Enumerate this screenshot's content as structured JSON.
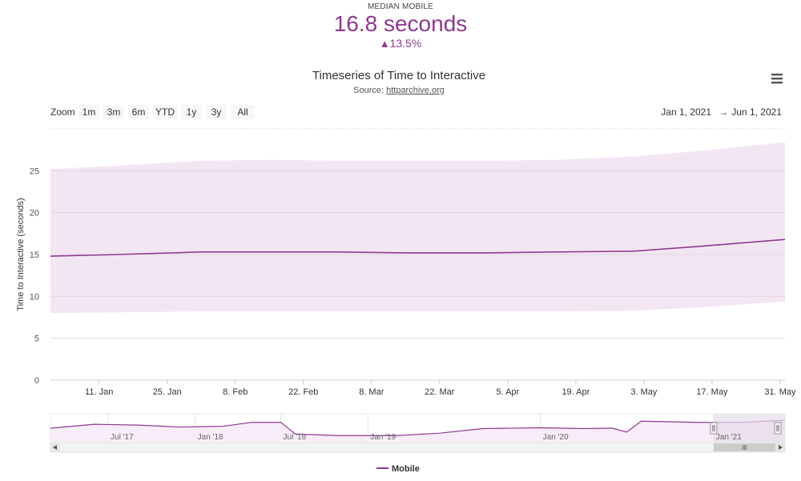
{
  "summary": {
    "label": "MEDIAN MOBILE",
    "value": "16.8 seconds",
    "change": "13.5%",
    "change_icon": "up-triangle-icon"
  },
  "colors": {
    "accent": "#8e3a91",
    "band": "#f3e6f3",
    "navigator_fill": "#f7ecf7",
    "navigator_mask": "#e6dde8"
  },
  "toolbar": {
    "zoom_label": "Zoom",
    "zoom_buttons": [
      "1m",
      "3m",
      "6m",
      "YTD",
      "1y",
      "3y",
      "All"
    ],
    "range_from": "Jan 1, 2021",
    "range_arrow": "→",
    "range_to": "Jun 1, 2021",
    "menu_icon": "hamburger-menu-icon"
  },
  "chart_data": {
    "type": "area",
    "title": "Timeseries of Time to Interactive",
    "subtitle_prefix": "Source: ",
    "subtitle_link": "httparchive.org",
    "ylabel": "Time to Interactive (seconds)",
    "ylim": [
      0,
      30
    ],
    "yticks": [
      0,
      5,
      10,
      15,
      20,
      25
    ],
    "xlim": [
      "2021-01-01",
      "2021-06-01"
    ],
    "xticks": [
      {
        "date": "2021-01-11",
        "label": "11. Jan"
      },
      {
        "date": "2021-01-25",
        "label": "25. Jan"
      },
      {
        "date": "2021-02-08",
        "label": "8. Feb"
      },
      {
        "date": "2021-02-22",
        "label": "22. Feb"
      },
      {
        "date": "2021-03-08",
        "label": "8. Mar"
      },
      {
        "date": "2021-03-22",
        "label": "22. Mar"
      },
      {
        "date": "2021-04-05",
        "label": "5. Apr"
      },
      {
        "date": "2021-04-19",
        "label": "19. Apr"
      },
      {
        "date": "2021-05-03",
        "label": "3. May"
      },
      {
        "date": "2021-05-17",
        "label": "17. May"
      },
      {
        "date": "2021-05-31",
        "label": "31. May"
      }
    ],
    "grid": true,
    "legend": "bottom-center",
    "series": [
      {
        "name": "Mobile",
        "points": [
          [
            "2021-01-01",
            14.8
          ],
          [
            "2021-01-15",
            15.0
          ],
          [
            "2021-02-01",
            15.3
          ],
          [
            "2021-02-15",
            15.3
          ],
          [
            "2021-03-01",
            15.3
          ],
          [
            "2021-03-15",
            15.2
          ],
          [
            "2021-04-01",
            15.2
          ],
          [
            "2021-04-15",
            15.3
          ],
          [
            "2021-05-01",
            15.4
          ],
          [
            "2021-05-15",
            16.0
          ],
          [
            "2021-06-01",
            16.8
          ]
        ]
      },
      {
        "name": "band",
        "points": [
          [
            "2021-01-01",
            8.0,
            25.2
          ],
          [
            "2021-01-15",
            8.1,
            25.6
          ],
          [
            "2021-02-01",
            8.2,
            26.2
          ],
          [
            "2021-02-15",
            8.2,
            26.3
          ],
          [
            "2021-03-01",
            8.2,
            26.2
          ],
          [
            "2021-03-15",
            8.2,
            26.2
          ],
          [
            "2021-04-01",
            8.2,
            26.2
          ],
          [
            "2021-04-15",
            8.2,
            26.3
          ],
          [
            "2021-05-01",
            8.3,
            26.7
          ],
          [
            "2021-05-15",
            8.7,
            27.4
          ],
          [
            "2021-06-01",
            9.4,
            28.4
          ]
        ]
      }
    ]
  },
  "navigator": {
    "labels": [
      {
        "date": "2017-07-01",
        "label": "Jul '17"
      },
      {
        "date": "2018-01-01",
        "label": "Jan '18"
      },
      {
        "date": "2018-07-01",
        "label": "Jul '18"
      },
      {
        "date": "2019-01-01",
        "label": "Jan '19"
      },
      {
        "date": "2020-01-01",
        "label": "Jan '20"
      },
      {
        "date": "2021-01-01",
        "label": "Jan '21"
      }
    ],
    "xlim": [
      "2017-03-01",
      "2021-06-01"
    ],
    "selection": [
      "2021-01-01",
      "2021-06-01"
    ],
    "points": [
      [
        "2017-03-01",
        11.5
      ],
      [
        "2017-06-01",
        12.5
      ],
      [
        "2017-09-01",
        12.3
      ],
      [
        "2017-12-01",
        11.8
      ],
      [
        "2018-03-01",
        12.0
      ],
      [
        "2018-05-01",
        13.0
      ],
      [
        "2018-07-01",
        13.0
      ],
      [
        "2018-08-01",
        10.0
      ],
      [
        "2018-11-01",
        9.6
      ],
      [
        "2019-03-01",
        9.6
      ],
      [
        "2019-06-01",
        10.2
      ],
      [
        "2019-09-01",
        11.4
      ],
      [
        "2020-01-01",
        11.6
      ],
      [
        "2020-04-01",
        11.4
      ],
      [
        "2020-06-01",
        11.5
      ],
      [
        "2020-07-01",
        10.5
      ],
      [
        "2020-08-01",
        13.3
      ],
      [
        "2020-12-01",
        13.0
      ],
      [
        "2021-03-01",
        13.0
      ],
      [
        "2021-06-01",
        13.5
      ]
    ]
  },
  "legend": {
    "items": [
      {
        "label": "Mobile"
      }
    ]
  }
}
